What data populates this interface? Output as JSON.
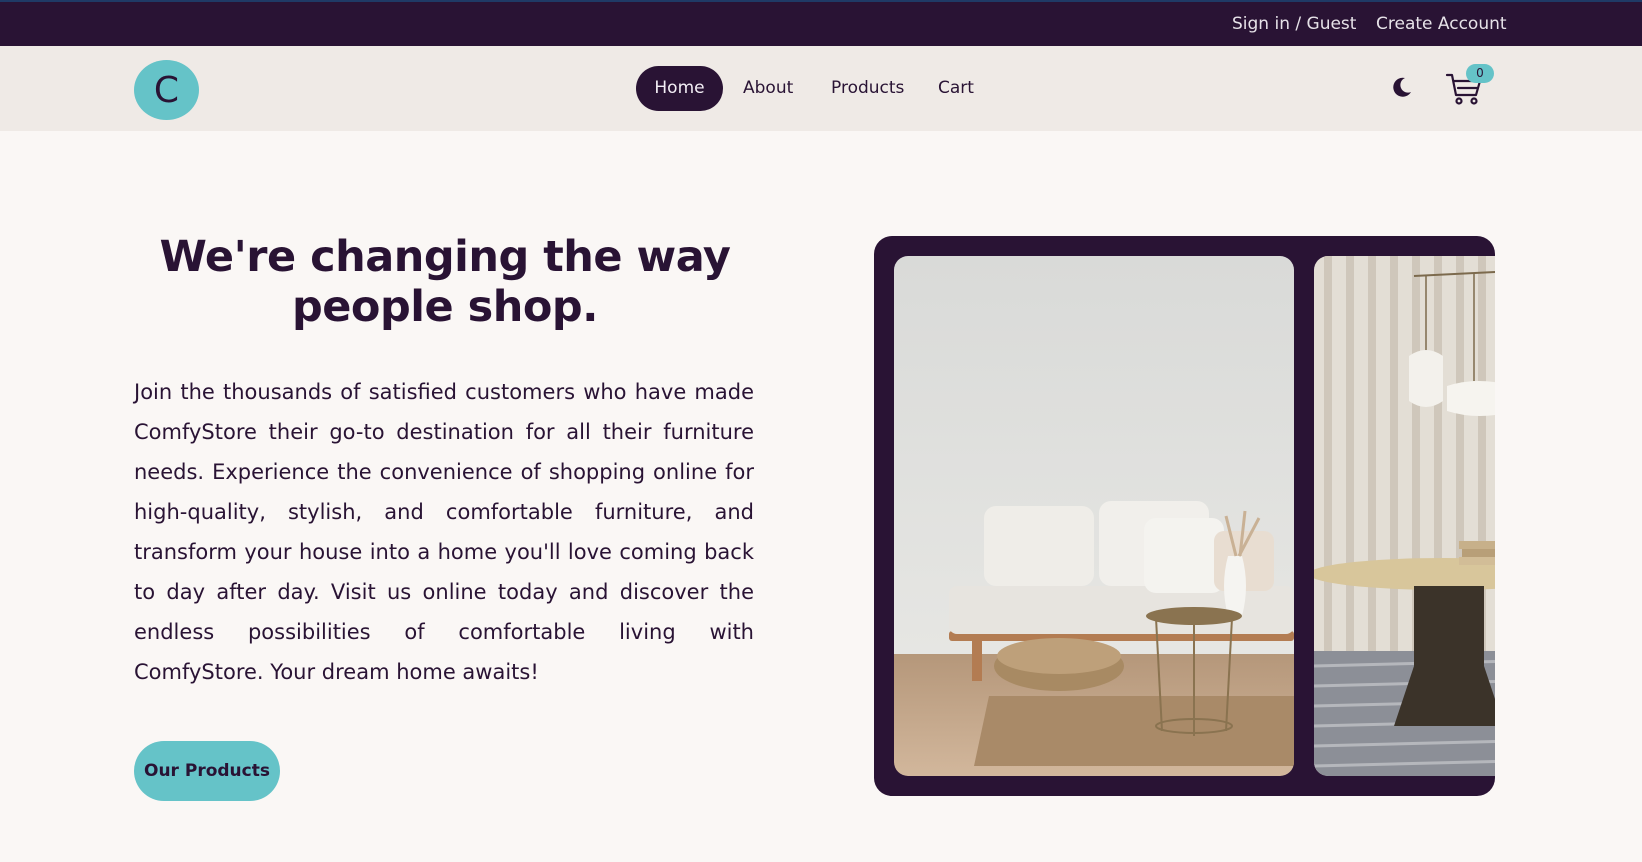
{
  "topbar": {
    "sign_in": "Sign in / Guest",
    "create_account": "Create Account"
  },
  "navbar": {
    "logo_letter": "C",
    "links": [
      "Home",
      "About",
      "Products",
      "Cart"
    ],
    "active": "Home",
    "theme_icon": "moon-icon",
    "cart_icon": "cart-icon",
    "cart_count": "0"
  },
  "hero": {
    "title": "We're changing the way people shop.",
    "text": "Join the thousands of satisfied customers who have made ComfyStore their go-to destination for all their furniture needs. Experience the convenience of shopping online for high-quality, stylish, and comfortable furniture, and transform your house into a home you'll love coming back to day after day. Visit us online today and discover the endless possibilities of comfortable living with ComfyStore. Your dream home awaits!",
    "button": "Our Products"
  },
  "colors": {
    "primary": "#291334",
    "accent": "#65c3c8",
    "background": "#faf7f5",
    "navbar": "#efeae6"
  }
}
